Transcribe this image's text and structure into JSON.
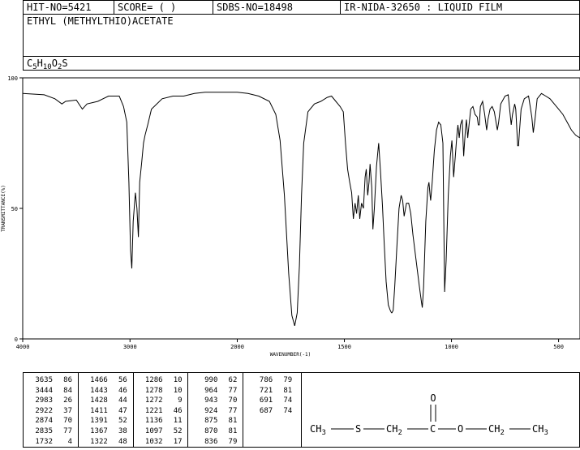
{
  "header": {
    "hit_no": "HIT-NO=5421",
    "score": "SCORE=  (   )",
    "sdbs_no": "SDBS-NO=18498",
    "ir_source": "IR-NIDA-32650 : LIQUID FILM"
  },
  "compound_name": "ETHYL (METHYLTHIO)ACETATE",
  "formula": {
    "parts": [
      {
        "t": "C",
        "sub": false
      },
      {
        "t": "5",
        "sub": true
      },
      {
        "t": "H",
        "sub": false
      },
      {
        "t": "10",
        "sub": true
      },
      {
        "t": "O",
        "sub": false
      },
      {
        "t": "2",
        "sub": true
      },
      {
        "t": "S",
        "sub": false
      }
    ]
  },
  "chart_data": {
    "type": "line",
    "title": "",
    "xlabel": "WAVENUMBER(-1)",
    "ylabel": "TRANSMITTANCE(%)",
    "xlim": [
      4000,
      400
    ],
    "ylim": [
      0,
      100
    ],
    "x_ticks": [
      4000,
      3000,
      2000,
      1500,
      1000,
      500
    ],
    "y_ticks": [
      0,
      50,
      100
    ],
    "grid": false,
    "series": [
      {
        "name": "",
        "points": [
          [
            4000,
            94
          ],
          [
            3800,
            93.5
          ],
          [
            3700,
            92
          ],
          [
            3635,
            90
          ],
          [
            3600,
            91
          ],
          [
            3500,
            91.5
          ],
          [
            3444,
            88
          ],
          [
            3400,
            90
          ],
          [
            3300,
            91
          ],
          [
            3200,
            93
          ],
          [
            3100,
            93
          ],
          [
            3060,
            89
          ],
          [
            3030,
            83
          ],
          [
            3010,
            60
          ],
          [
            2995,
            34
          ],
          [
            2983,
            27
          ],
          [
            2970,
            45
          ],
          [
            2950,
            56
          ],
          [
            2935,
            50
          ],
          [
            2922,
            39
          ],
          [
            2910,
            60
          ],
          [
            2890,
            68
          ],
          [
            2874,
            75
          ],
          [
            2860,
            78
          ],
          [
            2835,
            82
          ],
          [
            2800,
            88
          ],
          [
            2700,
            92
          ],
          [
            2600,
            93
          ],
          [
            2500,
            93
          ],
          [
            2400,
            94
          ],
          [
            2300,
            94.5
          ],
          [
            2200,
            94.5
          ],
          [
            2100,
            94.5
          ],
          [
            2000,
            94.5
          ],
          [
            1950,
            94
          ],
          [
            1900,
            93
          ],
          [
            1850,
            91
          ],
          [
            1820,
            86
          ],
          [
            1800,
            76
          ],
          [
            1780,
            55
          ],
          [
            1760,
            25
          ],
          [
            1745,
            9
          ],
          [
            1732,
            5
          ],
          [
            1720,
            10
          ],
          [
            1710,
            28
          ],
          [
            1700,
            55
          ],
          [
            1690,
            75
          ],
          [
            1670,
            87
          ],
          [
            1640,
            90
          ],
          [
            1610,
            91
          ],
          [
            1580,
            92.5
          ],
          [
            1560,
            93
          ],
          [
            1540,
            91
          ],
          [
            1520,
            89
          ],
          [
            1505,
            87
          ],
          [
            1495,
            75
          ],
          [
            1485,
            65
          ],
          [
            1475,
            60
          ],
          [
            1466,
            56
          ],
          [
            1458,
            46
          ],
          [
            1450,
            52
          ],
          [
            1443,
            48
          ],
          [
            1435,
            55
          ],
          [
            1428,
            46
          ],
          [
            1420,
            52
          ],
          [
            1411,
            50
          ],
          [
            1403,
            62
          ],
          [
            1398,
            65
          ],
          [
            1391,
            55
          ],
          [
            1385,
            60
          ],
          [
            1380,
            67
          ],
          [
            1372,
            58
          ],
          [
            1367,
            42
          ],
          [
            1360,
            50
          ],
          [
            1350,
            66
          ],
          [
            1340,
            75
          ],
          [
            1332,
            65
          ],
          [
            1322,
            51
          ],
          [
            1315,
            38
          ],
          [
            1305,
            22
          ],
          [
            1295,
            13
          ],
          [
            1286,
            11
          ],
          [
            1280,
            10
          ],
          [
            1278,
            10
          ],
          [
            1272,
            11
          ],
          [
            1265,
            20
          ],
          [
            1255,
            35
          ],
          [
            1245,
            50
          ],
          [
            1235,
            55
          ],
          [
            1228,
            53
          ],
          [
            1221,
            47
          ],
          [
            1210,
            52
          ],
          [
            1200,
            52
          ],
          [
            1190,
            48
          ],
          [
            1180,
            40
          ],
          [
            1165,
            30
          ],
          [
            1150,
            20
          ],
          [
            1140,
            14
          ],
          [
            1136,
            12
          ],
          [
            1130,
            20
          ],
          [
            1120,
            45
          ],
          [
            1110,
            58
          ],
          [
            1105,
            60
          ],
          [
            1100,
            55
          ],
          [
            1097,
            53
          ],
          [
            1090,
            60
          ],
          [
            1080,
            72
          ],
          [
            1070,
            80
          ],
          [
            1060,
            83
          ],
          [
            1050,
            82
          ],
          [
            1040,
            75
          ],
          [
            1032,
            18
          ],
          [
            1025,
            30
          ],
          [
            1015,
            55
          ],
          [
            1005,
            70
          ],
          [
            998,
            76
          ],
          [
            990,
            62
          ],
          [
            982,
            70
          ],
          [
            975,
            78
          ],
          [
            970,
            82
          ],
          [
            964,
            77
          ],
          [
            958,
            82
          ],
          [
            950,
            84
          ],
          [
            943,
            70
          ],
          [
            935,
            80
          ],
          [
            930,
            84
          ],
          [
            924,
            77
          ],
          [
            918,
            82
          ],
          [
            910,
            88
          ],
          [
            900,
            89
          ],
          [
            890,
            86
          ],
          [
            880,
            85
          ],
          [
            875,
            82
          ],
          [
            870,
            82
          ],
          [
            865,
            89
          ],
          [
            855,
            91
          ],
          [
            845,
            86
          ],
          [
            836,
            80
          ],
          [
            830,
            84
          ],
          [
            820,
            88
          ],
          [
            810,
            89
          ],
          [
            800,
            87
          ],
          [
            786,
            80
          ],
          [
            780,
            83
          ],
          [
            770,
            90
          ],
          [
            750,
            93
          ],
          [
            735,
            93.5
          ],
          [
            721,
            82
          ],
          [
            715,
            86
          ],
          [
            705,
            90
          ],
          [
            700,
            88
          ],
          [
            691,
            74
          ],
          [
            687,
            74
          ],
          [
            682,
            80
          ],
          [
            675,
            88
          ],
          [
            660,
            92
          ],
          [
            640,
            93
          ],
          [
            625,
            85
          ],
          [
            618,
            79
          ],
          [
            610,
            84
          ],
          [
            600,
            92
          ],
          [
            580,
            94
          ],
          [
            560,
            93
          ],
          [
            540,
            92
          ],
          [
            520,
            90
          ],
          [
            500,
            88
          ],
          [
            480,
            86
          ],
          [
            460,
            83
          ],
          [
            440,
            80
          ],
          [
            420,
            78
          ],
          [
            400,
            77
          ]
        ]
      }
    ]
  },
  "peak_table": {
    "columns": [
      [
        [
          "3635",
          "86"
        ],
        [
          "3444",
          "84"
        ],
        [
          "2983",
          "26"
        ],
        [
          "2922",
          "37"
        ],
        [
          "2874",
          "70"
        ],
        [
          "2835",
          "77"
        ],
        [
          "1732",
          "4"
        ]
      ],
      [
        [
          "1466",
          "56"
        ],
        [
          "1443",
          "46"
        ],
        [
          "1428",
          "44"
        ],
        [
          "1411",
          "47"
        ],
        [
          "1391",
          "52"
        ],
        [
          "1367",
          "38"
        ],
        [
          "1322",
          "48"
        ]
      ],
      [
        [
          "1286",
          "10"
        ],
        [
          "1278",
          "10"
        ],
        [
          "1272",
          "9"
        ],
        [
          "1221",
          "46"
        ],
        [
          "1136",
          "11"
        ],
        [
          "1097",
          "52"
        ],
        [
          "1032",
          "17"
        ]
      ],
      [
        [
          "990",
          "62"
        ],
        [
          "964",
          "77"
        ],
        [
          "943",
          "70"
        ],
        [
          "924",
          "77"
        ],
        [
          "875",
          "81"
        ],
        [
          "870",
          "81"
        ],
        [
          "836",
          "79"
        ]
      ],
      [
        [
          "786",
          "79"
        ],
        [
          "721",
          "81"
        ],
        [
          "691",
          "74"
        ],
        [
          "687",
          "74"
        ]
      ]
    ]
  },
  "structure": {
    "o_label": "O",
    "ch3_left": "CH",
    "ch3_left_sub": "3",
    "s_label": "S",
    "ch2_label": "CH",
    "ch2_sub": "2",
    "c_label": "C",
    "o_ester": "O",
    "ch2b_label": "CH",
    "ch2b_sub": "2",
    "ch3_right": "CH",
    "ch3_right_sub": "3"
  }
}
